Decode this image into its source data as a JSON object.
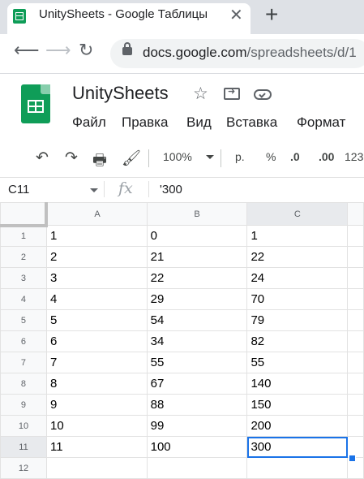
{
  "browser": {
    "tab_title": "UnitySheets - Google Таблицы",
    "close_label": "✕",
    "new_tab_label": "+",
    "url_host": "docs.google.com",
    "url_path": "/spreadsheets/d/1"
  },
  "doc": {
    "title": "UnitySheets",
    "menu": [
      "Файл",
      "Правка",
      "Вид",
      "Вставка",
      "Формат"
    ]
  },
  "toolbar": {
    "zoom": "100%",
    "currency": "р.",
    "percent": "%",
    "dec_decrease": ".0",
    "dec_increase": ".00",
    "more_formats": "123"
  },
  "formula_bar": {
    "name_box": "C11",
    "fx": "fx",
    "formula": "'300"
  },
  "sheet": {
    "columns": [
      "A",
      "B",
      "C"
    ],
    "rows": [
      {
        "n": "1",
        "a": "1",
        "b": "0",
        "c": "1"
      },
      {
        "n": "2",
        "a": "2",
        "b": "21",
        "c": "22"
      },
      {
        "n": "3",
        "a": "3",
        "b": "22",
        "c": "24"
      },
      {
        "n": "4",
        "a": "4",
        "b": "29",
        "c": "70"
      },
      {
        "n": "5",
        "a": "5",
        "b": "54",
        "c": "79"
      },
      {
        "n": "6",
        "a": "6",
        "b": "34",
        "c": "82"
      },
      {
        "n": "7",
        "a": "7",
        "b": "55",
        "c": "55"
      },
      {
        "n": "8",
        "a": "8",
        "b": "67",
        "c": "140"
      },
      {
        "n": "9",
        "a": "9",
        "b": "88",
        "c": "150"
      },
      {
        "n": "10",
        "a": "10",
        "b": "99",
        "c": "200"
      },
      {
        "n": "11",
        "a": "11",
        "b": "100",
        "c": "300"
      },
      {
        "n": "12",
        "a": "",
        "b": "",
        "c": ""
      }
    ],
    "selected_cell": "C11",
    "selection_color": "#1a73e8"
  }
}
